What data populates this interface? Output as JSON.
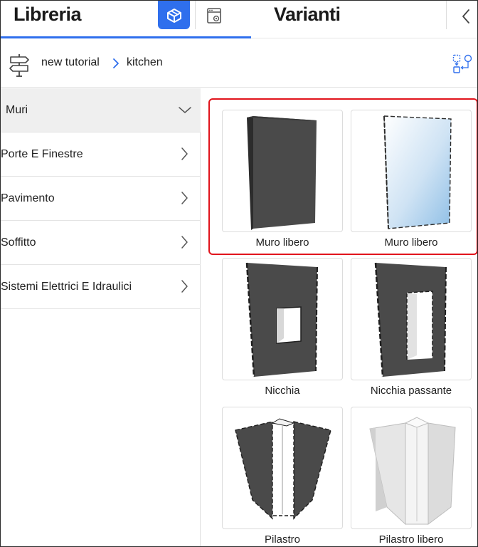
{
  "header": {
    "title": "Libreria",
    "variants_title": "Varianti",
    "tabs": [
      {
        "icon": "box-icon",
        "active": true
      },
      {
        "icon": "window-settings-icon",
        "active": false
      }
    ],
    "collapse_icon": "chevron-left-icon"
  },
  "breadcrumb": {
    "icon": "signpost-icon",
    "items": [
      "new tutorial",
      "kitchen"
    ],
    "action_icon": "swap-icon"
  },
  "categories": [
    {
      "label": "Muri",
      "expanded": true
    },
    {
      "label": "Porte E Finestre",
      "expanded": false
    },
    {
      "label": "Pavimento",
      "expanded": false
    },
    {
      "label": "Soffitto",
      "expanded": false
    },
    {
      "label": "Sistemi Elettrici E Idraulici",
      "expanded": false
    }
  ],
  "items": [
    {
      "label": "Muro libero",
      "selected": true
    },
    {
      "label": "Muro libero",
      "selected": true
    },
    {
      "label": "Nicchia",
      "selected": false
    },
    {
      "label": "Nicchia passante",
      "selected": false
    },
    {
      "label": "Pilastro",
      "selected": false
    },
    {
      "label": "Pilastro libero",
      "selected": false
    }
  ],
  "colors": {
    "accent": "#2f6fed",
    "selection": "#e1141c",
    "wall": "#4a4a4a",
    "glass": "#a8cdea"
  }
}
